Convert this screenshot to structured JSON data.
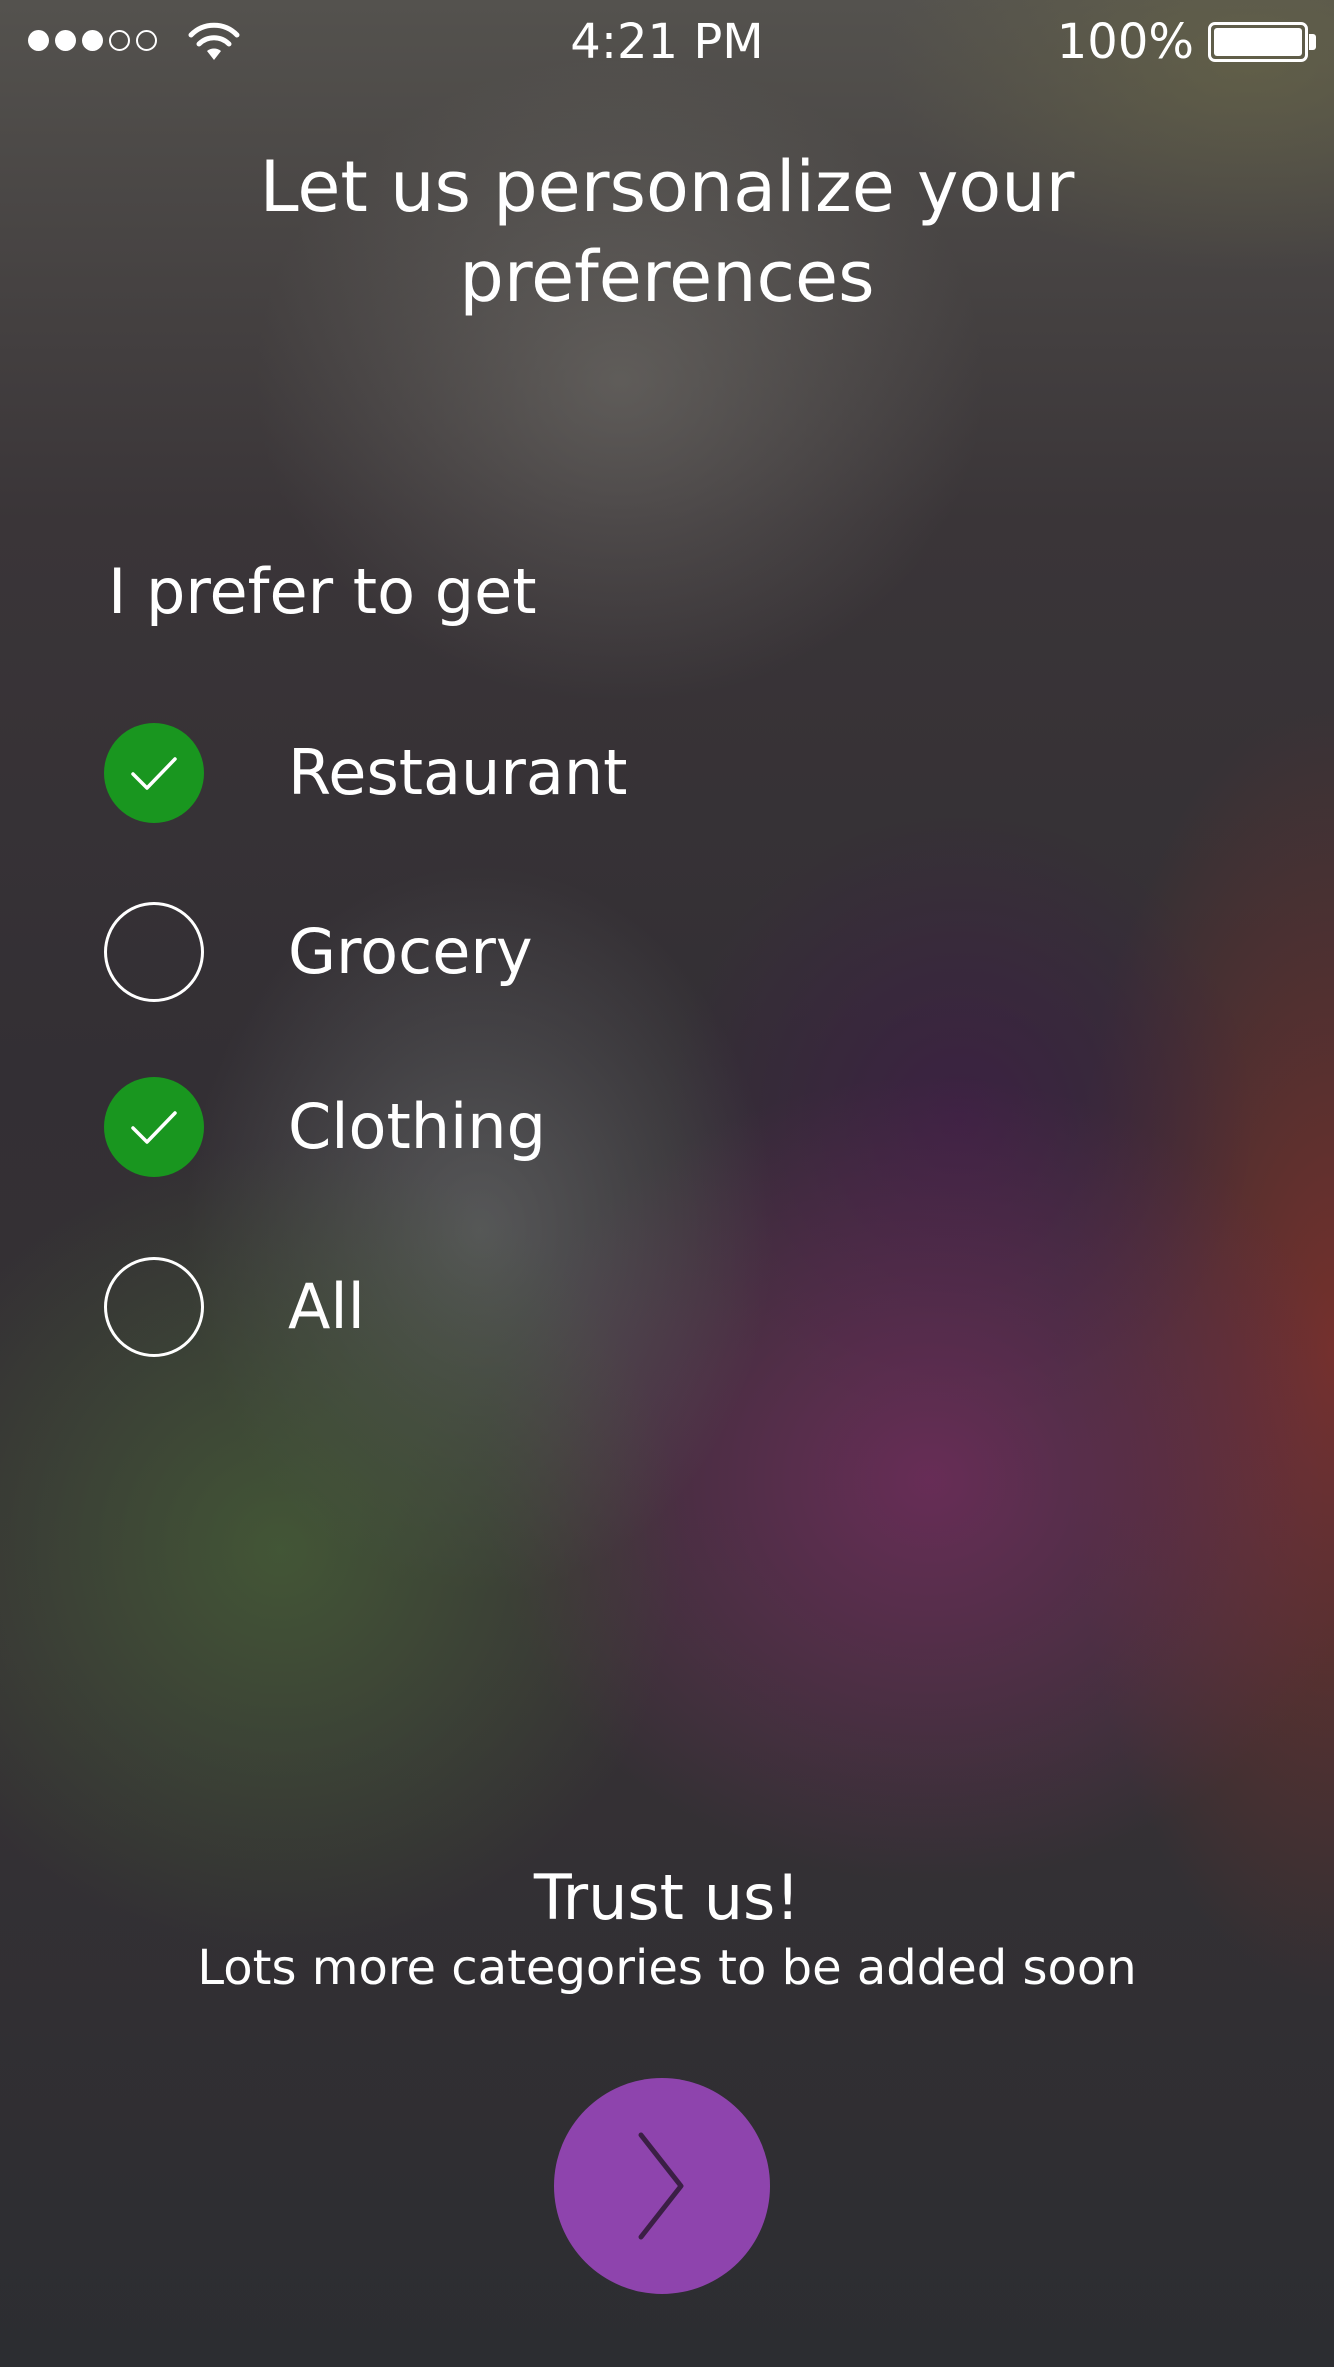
{
  "status_bar": {
    "signal_bars_filled": 3,
    "signal_bars_total": 5,
    "wifi_icon": "wifi-icon",
    "time": "4:21 PM",
    "battery_percent": "100%",
    "battery_icon": "battery-icon"
  },
  "header": {
    "title_line1": "Let us personalize your",
    "title_line2": "preferences"
  },
  "preferences": {
    "label": "I prefer to get",
    "options": [
      {
        "label": "Restaurant",
        "checked": true
      },
      {
        "label": "Grocery",
        "checked": false
      },
      {
        "label": "Clothing",
        "checked": true
      },
      {
        "label": "All",
        "checked": false
      }
    ]
  },
  "footer": {
    "title": "Trust us!",
    "subtitle": "Lots more categories to be added soon",
    "next_icon": "chevron-right-icon"
  },
  "colors": {
    "checked": "#19961f",
    "next_button": "#8e44ad",
    "chevron": "#3b1f45",
    "text": "#ffffff"
  }
}
